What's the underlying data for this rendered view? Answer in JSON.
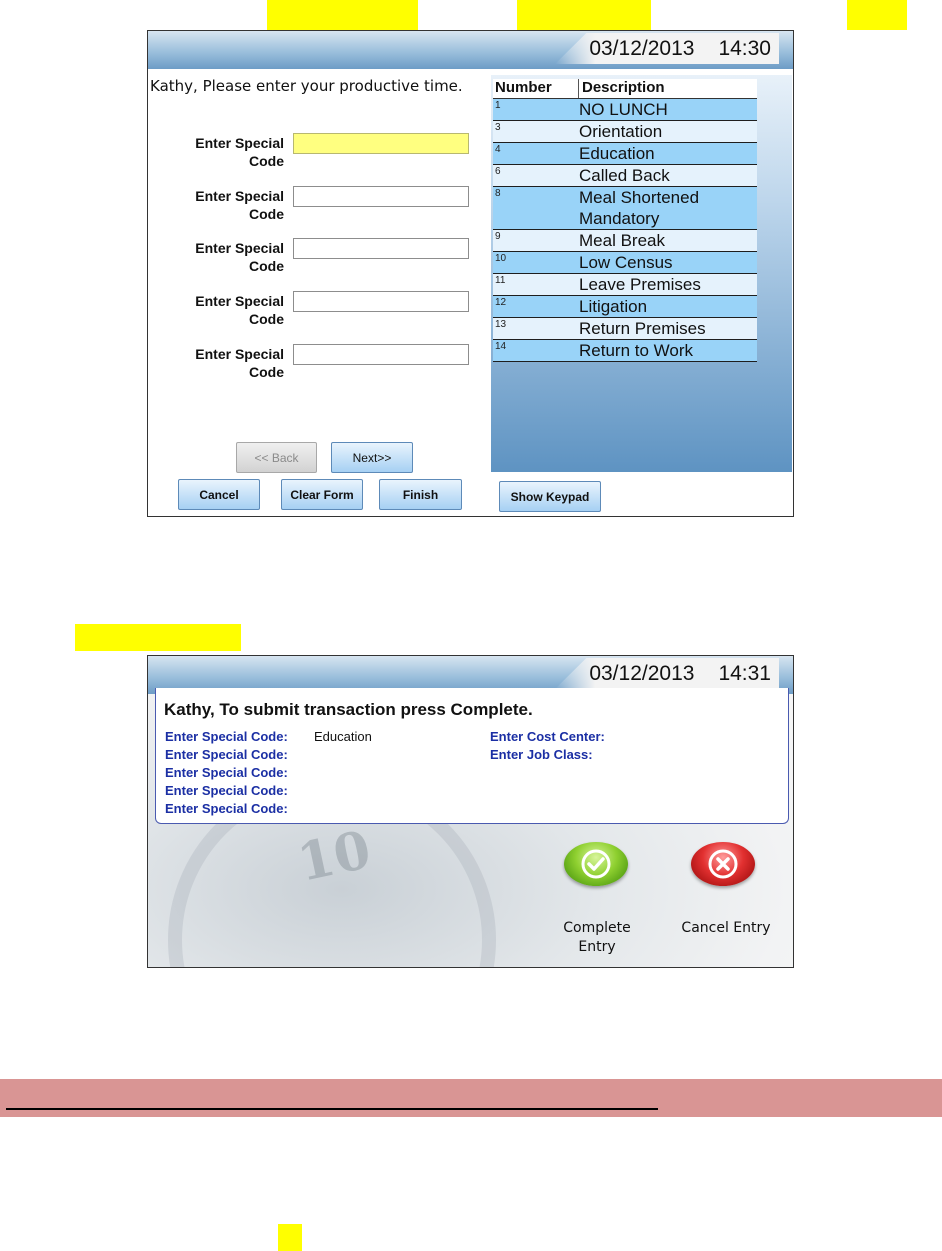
{
  "screen1": {
    "datetime": {
      "date": "03/12/2013",
      "time": "14:30"
    },
    "prompt": "Kathy, Please enter your productive time.",
    "field_label_line1": "Enter Special",
    "field_label_line2": "Code",
    "fields": [
      "",
      "",
      "",
      "",
      ""
    ],
    "buttons": {
      "back": "<< Back",
      "next": "Next>>",
      "cancel": "Cancel",
      "clear_form": "Clear Form",
      "finish": "Finish",
      "show_keypad": "Show Keypad"
    },
    "table": {
      "headers": {
        "number": "Number",
        "description": "Description"
      },
      "rows": [
        {
          "num": "1",
          "desc": "NO LUNCH"
        },
        {
          "num": "3",
          "desc": "Orientation"
        },
        {
          "num": "4",
          "desc": "Education"
        },
        {
          "num": "6",
          "desc": "Called Back"
        },
        {
          "num": "8",
          "desc": "Meal Shortened Mandatory"
        },
        {
          "num": "9",
          "desc": "Meal Break"
        },
        {
          "num": "10",
          "desc": "Low Census"
        },
        {
          "num": "11",
          "desc": "Leave Premises"
        },
        {
          "num": "12",
          "desc": "Litigation"
        },
        {
          "num": "13",
          "desc": "Return Premises"
        },
        {
          "num": "14",
          "desc": "Return to Work"
        }
      ]
    }
  },
  "screen2": {
    "datetime": {
      "date": "03/12/2013",
      "time": "14:31"
    },
    "title": "Kathy, To submit transaction press Complete.",
    "special_code_label": "Enter Special Code:",
    "special_code_values": [
      "Education",
      "",
      "",
      "",
      ""
    ],
    "cost_center_label": "Enter Cost Center:",
    "job_class_label": "Enter Job Class:",
    "complete_label": "Complete Entry",
    "cancel_label": "Cancel Entry"
  },
  "colors": {
    "highlight": "#ffff00",
    "active_field": "#ffff80",
    "row_odd": "#99d3f8",
    "row_even": "#e5f2fc",
    "label_blue": "#1b2fa4",
    "band": "#d99594"
  }
}
